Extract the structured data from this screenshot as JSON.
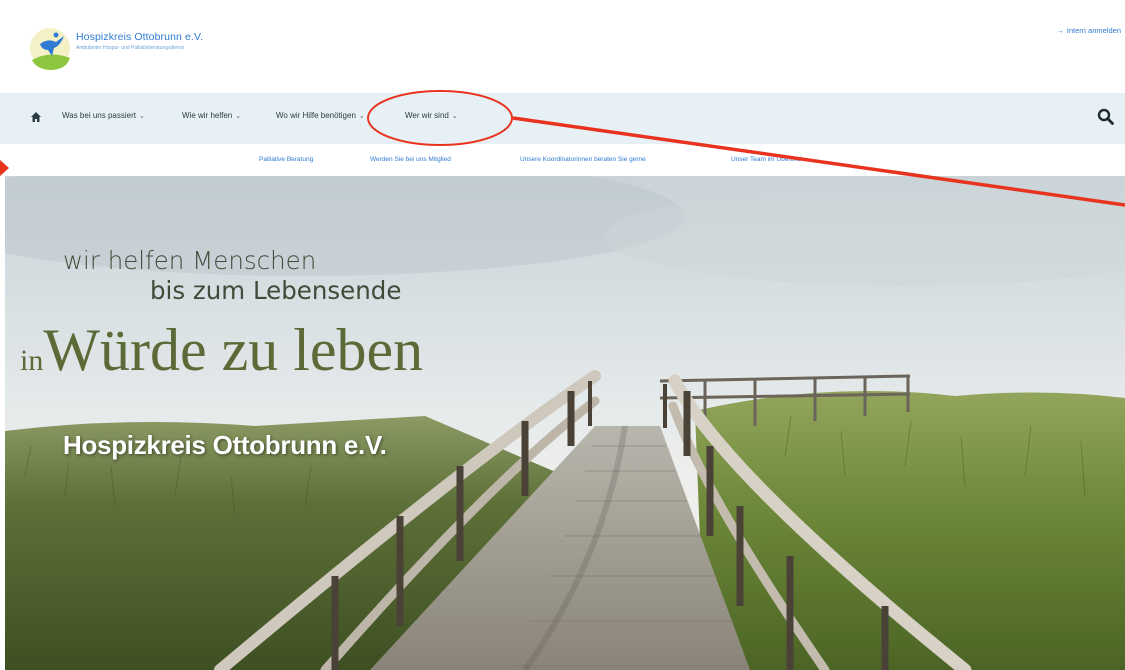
{
  "header": {
    "brand_title": "Hospizkreis Ottobrunn e.V.",
    "brand_subtitle": "Ambulanter Hospiz- und Palliativberatungsdienst",
    "login_label": "Intern anmelden",
    "login_icon": "login-arrow-icon"
  },
  "nav": {
    "home_icon": "home-icon",
    "items": [
      {
        "label": "Was bei uns passiert"
      },
      {
        "label": "Wie wir helfen"
      },
      {
        "label": "Wo wir Hilfe benötigen"
      },
      {
        "label": "Wer wir sind"
      }
    ],
    "search_icon": "search-icon"
  },
  "submenu": {
    "items": [
      {
        "label": "Palliative Beratung"
      },
      {
        "label": "Werden Sie bei uns Mitglied"
      },
      {
        "label": "Unsere Koordinatorinnen beraten Sie gerne"
      },
      {
        "label": "Unser Team im Überblick"
      }
    ]
  },
  "hero": {
    "line1": "wir helfen Menschen",
    "line2": "bis zum Lebensende",
    "line3_prefix": "in",
    "line3_main": "Würde zu leben",
    "brand": "Hospizkreis Ottobrunn e.V."
  },
  "colors": {
    "link_blue": "#2f7bd3",
    "nav_bg": "#e7f1f5",
    "annotation_red": "#e8331f",
    "headline_green": "#5b6a37"
  }
}
